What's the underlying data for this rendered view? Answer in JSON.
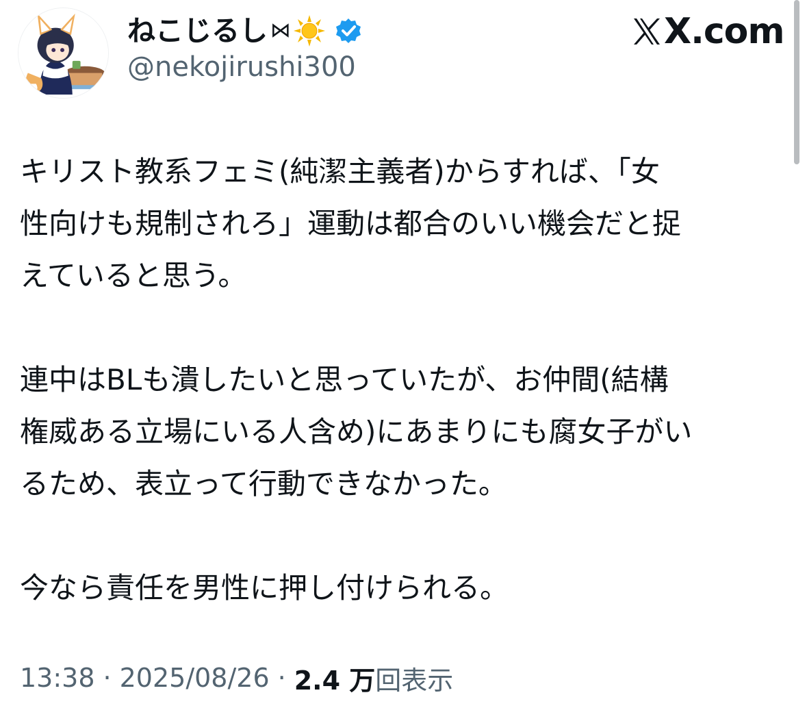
{
  "header": {
    "display_name": "ねこじるし",
    "name_emoji_bowtie": "⋈",
    "handle": "@nekojirushi300",
    "brand": "X.com",
    "icons": {
      "avatar": "fox-girl-avatar",
      "sun": "sun-icon",
      "verified": "verified-badge-icon",
      "verified_color": "#1d9bf0",
      "sun_color": "#f5b800"
    }
  },
  "tweet": {
    "paragraphs": [
      "キリスト教系フェミ(純潔主義者)からすれば、「女\n性向けも規制されろ」運動は都合のいい機会だと捉\nえていると思う。",
      "連中はBLも潰したいと思っていたが、お仲間(結構\n権威ある立場にいる人含め)にあまりにも腐女子がい\nるため、表立って行動できなかった。",
      "今なら責任を男性に押し付けられる。"
    ]
  },
  "meta": {
    "time": "13:38",
    "separator": "·",
    "date": "2025/08/26",
    "view_count": "2.4 万",
    "view_label": "回表示"
  },
  "colors": {
    "text_primary": "#0f1419",
    "text_secondary": "#536471",
    "background": "#ffffff"
  }
}
